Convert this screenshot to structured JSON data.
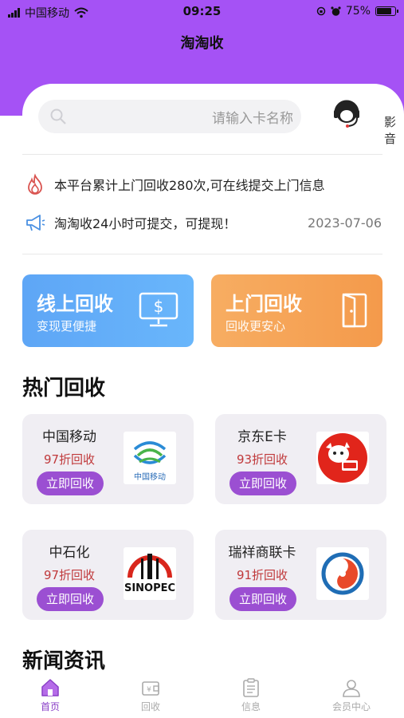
{
  "status_bar": {
    "carrier": "中国移动",
    "time": "09:25",
    "battery": "75%"
  },
  "header": {
    "title": "淘淘收"
  },
  "search": {
    "placeholder": "请输入卡名称"
  },
  "top_right_label": "影音",
  "notices": [
    {
      "text": "本平台累计上门回收280次,可在线提交上门信息",
      "icon": "flame-icon"
    },
    {
      "text": "淘淘收24小时可提交，可提现！",
      "date": "2023-07-06",
      "icon": "megaphone-icon"
    }
  ],
  "actions": {
    "online": {
      "title": "线上回收",
      "subtitle": "变现更便捷",
      "icon": "monitor-dollar-icon"
    },
    "door": {
      "title": "上门回收",
      "subtitle": "回收更安心",
      "icon": "door-icon"
    }
  },
  "hot_section": {
    "title": "热门回收"
  },
  "products": [
    {
      "name": "中国移动",
      "discount": "97折回收",
      "button": "立即回收",
      "logo_text": "中国移动"
    },
    {
      "name": "京东E卡",
      "discount": "93折回收",
      "button": "立即回收"
    },
    {
      "name": "中石化",
      "discount": "97折回收",
      "button": "立即回收"
    },
    {
      "name": "瑞祥商联卡",
      "discount": "91折回收",
      "button": "立即回收"
    }
  ],
  "news_section": {
    "title": "新闻资讯"
  },
  "tabs": [
    {
      "label": "首页",
      "icon": "home-icon",
      "active": true
    },
    {
      "label": "回收",
      "icon": "wallet-icon"
    },
    {
      "label": "信息",
      "icon": "clipboard-icon"
    },
    {
      "label": "会员中心",
      "icon": "user-icon"
    }
  ],
  "colors": {
    "brand_purple": "#a552f5",
    "button_purple": "#9b4fd2",
    "discount_red": "#c0393b",
    "online_blue": "#5ea6f6",
    "door_orange": "#f49a4b"
  }
}
